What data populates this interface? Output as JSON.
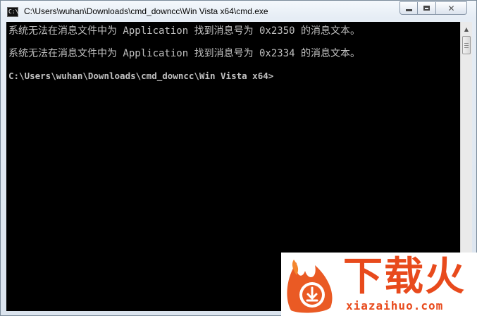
{
  "window": {
    "title": "C:\\Users\\wuhan\\Downloads\\cmd_downcc\\Win Vista x64\\cmd.exe",
    "icon_text": "C:\\"
  },
  "caption_buttons": {
    "minimize_icon": "minimize-icon",
    "maximize_icon": "maximize-icon",
    "close_icon": "close-icon"
  },
  "console": {
    "lines": [
      "系统无法在消息文件中为 Application 找到消息号为 0x2350 的消息文本。",
      "系统无法在消息文件中为 Application 找到消息号为 0x2334 的消息文本。",
      "C:\\Users\\wuhan\\Downloads\\cmd_downcc\\Win Vista x64>"
    ],
    "text_color": "#c0c0c0",
    "background": "#000000"
  },
  "watermark": {
    "brand": "下载火",
    "domain": "xiazaihuo.com",
    "color": "#e84a1c"
  }
}
